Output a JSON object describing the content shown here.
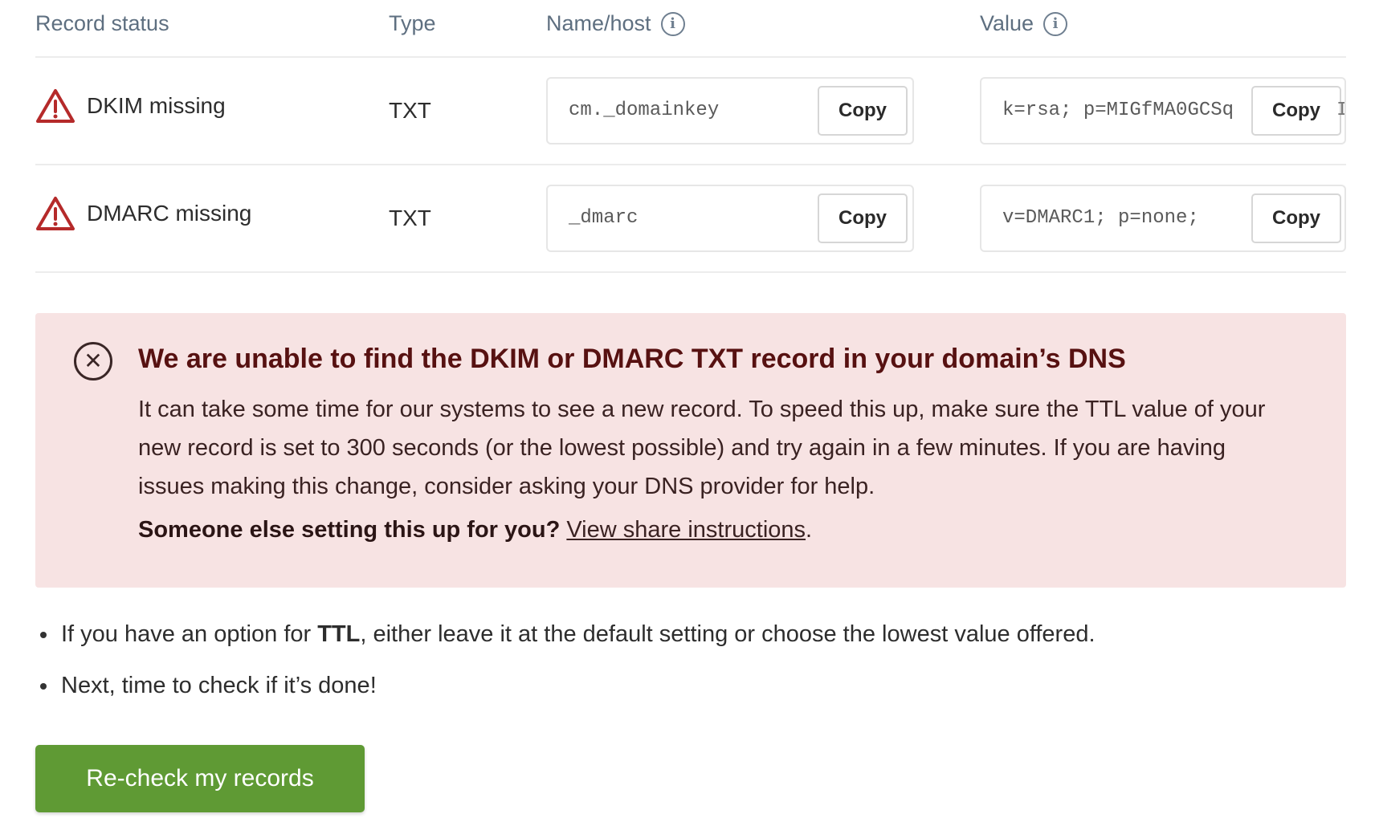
{
  "table": {
    "headers": {
      "status": "Record status",
      "type": "Type",
      "name": "Name/host",
      "value": "Value"
    },
    "rows": [
      {
        "status": "DKIM missing",
        "type": "TXT",
        "name": "cm._domainkey",
        "value": "k=rsa; p=MIGfMA0GCSq",
        "value_overflow": "I",
        "copy": "Copy"
      },
      {
        "status": "DMARC missing",
        "type": "TXT",
        "name": "_dmarc",
        "value": "v=DMARC1; p=none;",
        "copy": "Copy"
      }
    ]
  },
  "alert": {
    "icon": "close-circle-icon",
    "title": "We are unable to find the DKIM or DMARC TXT record in your domain’s DNS",
    "body": "It can take some time for our systems to see a new record. To speed this up, make sure the TTL value of your new record is set to 300 seconds (or the lowest possible) and try again in a few minutes. If you are having issues making this change, consider asking your DNS provider for help.",
    "share_prompt": "Someone else setting this up for you?",
    "share_link": "View share instructions",
    "share_suffix": "."
  },
  "bullets": {
    "ttl_prefix": "If you have an option for ",
    "ttl_bold": "TTL",
    "ttl_suffix": ", either leave it at the default setting or choose the lowest value offered.",
    "next": "Next, time to check if it’s done!"
  },
  "recheck_button": "Re-check my records",
  "colors": {
    "alert_bg": "#f7e3e3",
    "alert_title": "#571111",
    "warning_red": "#b52a2a",
    "button_green": "#5f9a34"
  }
}
